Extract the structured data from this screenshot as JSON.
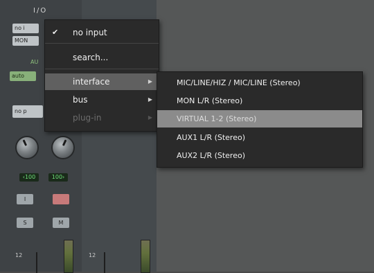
{
  "strip": {
    "io_label": "I/O",
    "input_slot": "no i",
    "output_slot": "MON",
    "auto_slot": "auto",
    "auto_label": "AU",
    "insert_slot": "no p",
    "pan_left": "‹100",
    "pan_right": "100›",
    "btn_rec": "I",
    "btn_input": "",
    "btn_solo": "S",
    "btn_mute": "M",
    "fader_label_left": "12",
    "fader_label_right": "12"
  },
  "menu": {
    "items": [
      {
        "label": "no input",
        "checked": true
      },
      {
        "label": "search..."
      },
      {
        "label": "interface",
        "submenu": true,
        "highlighted": true
      },
      {
        "label": "bus",
        "submenu": true
      },
      {
        "label": "plug-in",
        "submenu": true,
        "disabled": true
      }
    ],
    "check_icon": "checkmark-icon",
    "arrow_icon": "submenu-arrow-icon"
  },
  "submenu": {
    "items": [
      {
        "label": "MIC/LINE/HIZ / MIC/LINE (Stereo)"
      },
      {
        "label": "MON L/R (Stereo)"
      },
      {
        "label": "VIRTUAL 1-2 (Stereo)",
        "highlighted": true
      },
      {
        "label": "AUX1 L/R (Stereo)"
      },
      {
        "label": "AUX2 L/R (Stereo)"
      }
    ]
  },
  "colors": {
    "menu_bg": "#2a2a2a",
    "menu_highlight": "#606060",
    "submenu_highlight": "#8b8b8b",
    "pan_text": "#6ee07a"
  }
}
